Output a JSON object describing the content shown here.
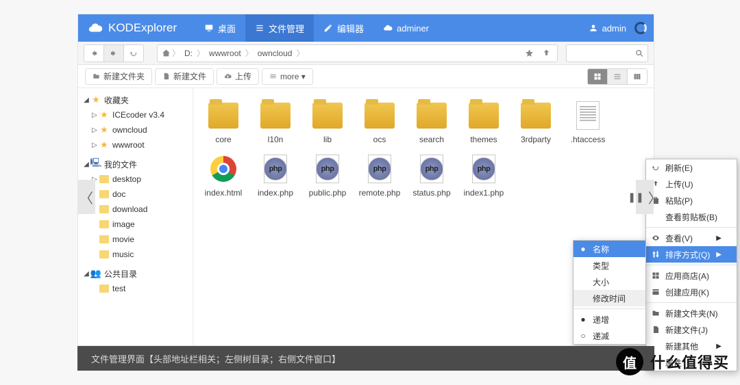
{
  "brand": "KODExplorer",
  "topnav": {
    "desktop": "桌面",
    "files": "文件管理",
    "editor": "编辑器",
    "adminer": "adminer"
  },
  "user": "admin",
  "breadcrumb": {
    "drive": "D:",
    "a": "wwwroot",
    "b": "owncloud"
  },
  "toolbar": {
    "newfolder": "新建文件夹",
    "newfile": "新建文件",
    "upload": "上传",
    "more": "more ▾"
  },
  "sidebar": {
    "fav": "收藏夹",
    "fav_icecoder": "ICEcoder v3.4",
    "fav_owncloud": "owncloud",
    "fav_wwwroot": "wwwroot",
    "my": "我的文件",
    "my_items": {
      "0": "desktop",
      "1": "doc",
      "2": "download",
      "3": "image",
      "4": "movie",
      "5": "music"
    },
    "pub": "公共目录",
    "pub_test": "test"
  },
  "files": {
    "0": "core",
    "1": "l10n",
    "2": "lib",
    "3": "ocs",
    "4": "search",
    "5": "themes",
    "6": "3rdparty",
    "7": ".htaccess",
    "8": "index.html",
    "9": "index.php",
    "10": "public.php",
    "11": "remote.php",
    "12": "status.php",
    "13": "index1.php"
  },
  "ctx": {
    "refresh": "刷新(E)",
    "upload": "上传(U)",
    "paste": "粘贴(P)",
    "clipboard": "查看剪贴板(B)",
    "view": "查看(V)",
    "sort": "排序方式(Q)",
    "store": "应用商店(A)",
    "createapp": "创建应用(K)",
    "newfolder": "新建文件夹(N)",
    "newfile": "新建文件(J)",
    "newother": "新建其他",
    "prop": "属性"
  },
  "sortmenu": {
    "name": "名称",
    "type": "类型",
    "size": "大小",
    "mtime": "修改时间",
    "asc": "递增",
    "desc": "递减"
  },
  "footer": "文件管理界面【头部地址栏相关；左侧树目录；右侧文件窗口】",
  "php_label": "php",
  "badge": {
    "char": "值",
    "text": "什么值得买"
  }
}
